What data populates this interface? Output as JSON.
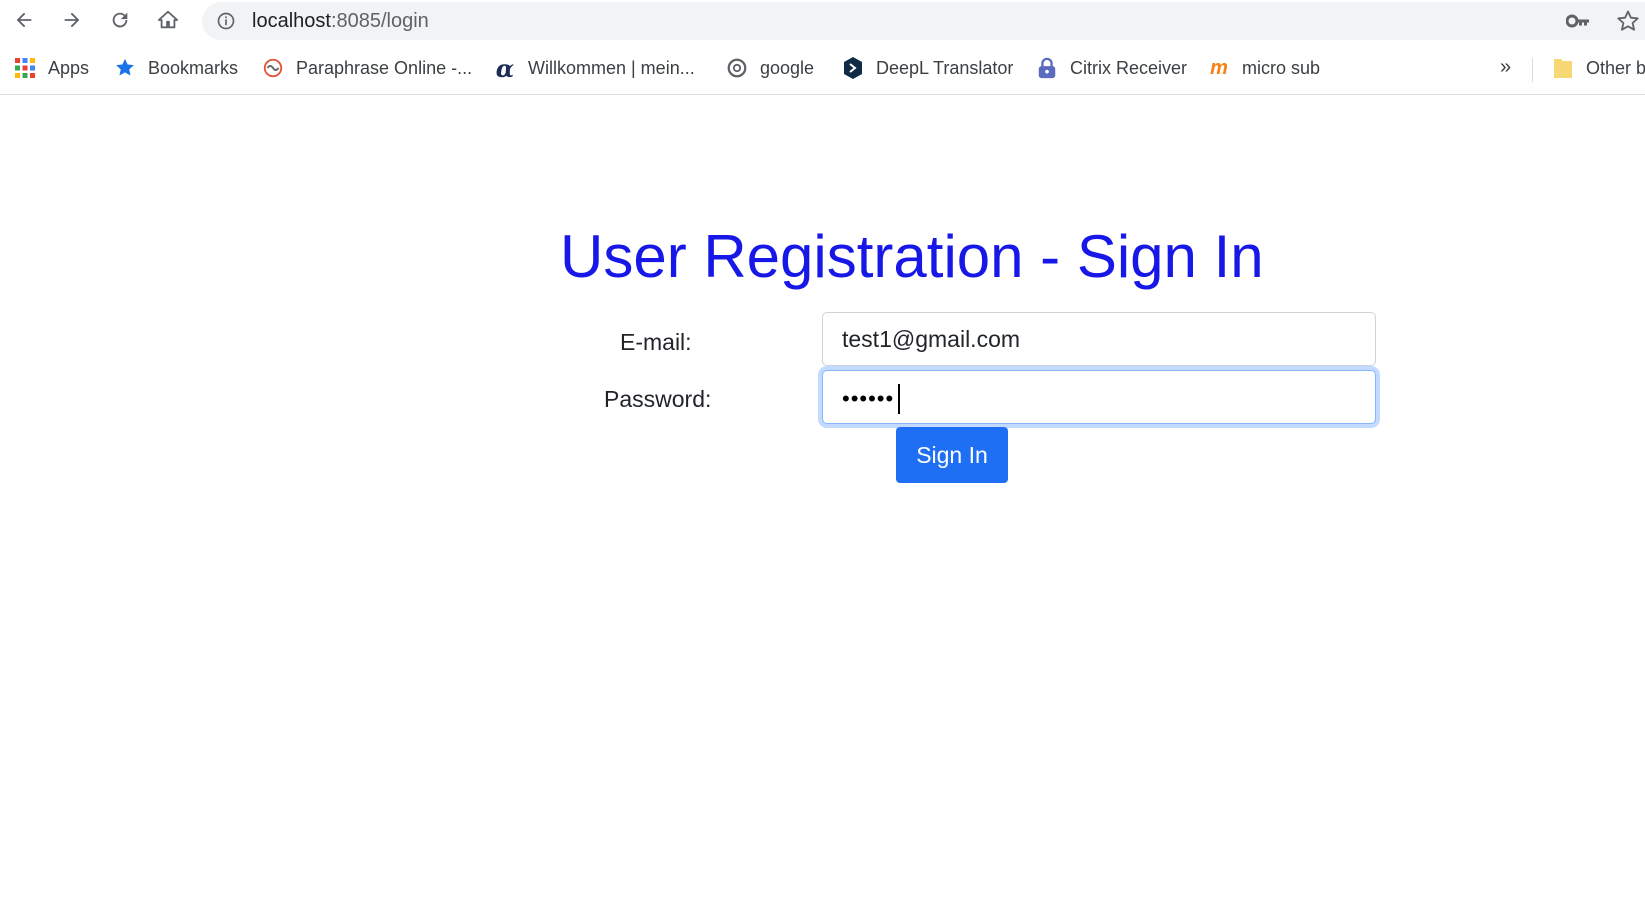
{
  "browser": {
    "url_host": "localhost",
    "url_path": ":8085/login",
    "bookmarks": [
      {
        "label": "Apps",
        "icon": "apps-grid-icon"
      },
      {
        "label": "Bookmarks",
        "icon": "star-icon"
      },
      {
        "label": "Paraphrase Online -...",
        "icon": "paraphrase-icon"
      },
      {
        "label": "Willkommen | mein...",
        "icon": "alpha-icon"
      },
      {
        "label": "google",
        "icon": "chrome-icon"
      },
      {
        "label": "DeepL Translator",
        "icon": "deepl-icon"
      },
      {
        "label": "Citrix Receiver",
        "icon": "lock-icon"
      },
      {
        "label": "micro sub",
        "icon": "moodle-icon"
      }
    ],
    "overflow_label": "»",
    "other_bookmarks_label": "Other b"
  },
  "page": {
    "title": "User Registration - Sign In",
    "email_label": "E-mail:",
    "email_value": "test1@gmail.com",
    "password_label": "Password:",
    "password_masked": "••••••",
    "submit_label": "Sign In"
  },
  "colors": {
    "title": "#1717e8",
    "button": "#1f6ff5",
    "focus_ring": "#86b7fe"
  }
}
